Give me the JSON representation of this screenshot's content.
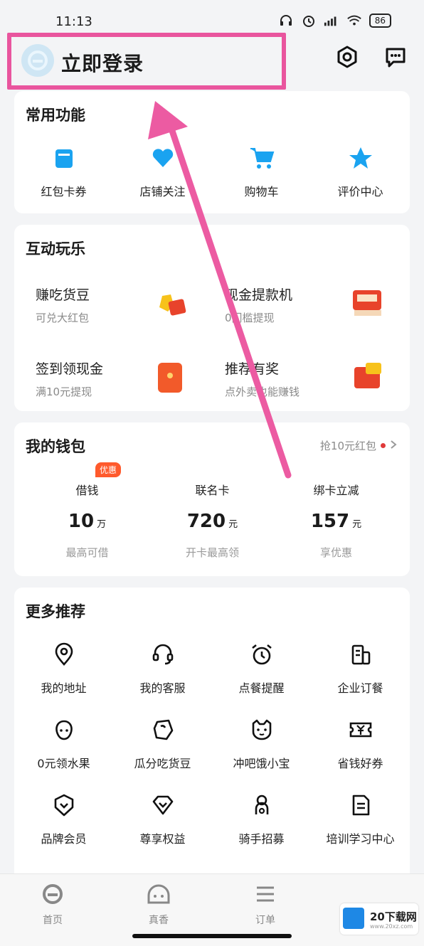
{
  "status": {
    "time": "11:13",
    "battery": "86"
  },
  "header": {
    "login_label": "立即登录"
  },
  "common": {
    "title": "常用功能",
    "items": [
      {
        "label": "红包卡券",
        "icon": "wallet-icon"
      },
      {
        "label": "店铺关注",
        "icon": "heart-icon"
      },
      {
        "label": "购物车",
        "icon": "cart-icon"
      },
      {
        "label": "评价中心",
        "icon": "star-icon"
      }
    ]
  },
  "fun": {
    "title": "互动玩乐",
    "items": [
      {
        "title": "赚吃货豆",
        "sub": "可兑大红包"
      },
      {
        "title": "现金提款机",
        "sub": "0门槛提现"
      },
      {
        "title": "签到领现金",
        "sub": "满10元提现"
      },
      {
        "title": "推荐有奖",
        "sub": "点外卖也能赚钱"
      }
    ]
  },
  "wallet": {
    "title": "我的钱包",
    "link": "抢10元红包",
    "badge": "优惠",
    "cols": [
      {
        "label": "借钱",
        "value": "10",
        "unit": "万",
        "sub": "最高可借"
      },
      {
        "label": "联名卡",
        "value": "720",
        "unit": "元",
        "sub": "开卡最高领"
      },
      {
        "label": "绑卡立减",
        "value": "157",
        "unit": "元",
        "sub": "享优惠"
      }
    ]
  },
  "more": {
    "title": "更多推荐",
    "rows": [
      [
        {
          "label": "我的地址",
          "icon": "location-icon"
        },
        {
          "label": "我的客服",
          "icon": "headset-icon"
        },
        {
          "label": "点餐提醒",
          "icon": "alarm-icon"
        },
        {
          "label": "企业订餐",
          "icon": "building-icon"
        }
      ],
      [
        {
          "label": "0元领水果",
          "icon": "fruit-icon"
        },
        {
          "label": "瓜分吃货豆",
          "icon": "bean-icon"
        },
        {
          "label": "冲吧饿小宝",
          "icon": "cat-icon"
        },
        {
          "label": "省钱好券",
          "icon": "coupon-icon"
        }
      ],
      [
        {
          "label": "品牌会员",
          "icon": "shield-icon"
        },
        {
          "label": "尊享权益",
          "icon": "diamond-icon"
        },
        {
          "label": "骑手招募",
          "icon": "rider-icon"
        },
        {
          "label": "培训学习中心",
          "icon": "book-icon"
        }
      ]
    ]
  },
  "tabs": [
    {
      "label": "首页",
      "icon": "home-icon"
    },
    {
      "label": "真香",
      "icon": "bowl-icon"
    },
    {
      "label": "订单",
      "icon": "list-icon"
    }
  ],
  "watermark": {
    "text": "20下载网",
    "sub": "www.20xz.com"
  },
  "colors": {
    "highlight": "#e9559e",
    "accent": "#1aa3f0",
    "red": "#e03a3a"
  }
}
